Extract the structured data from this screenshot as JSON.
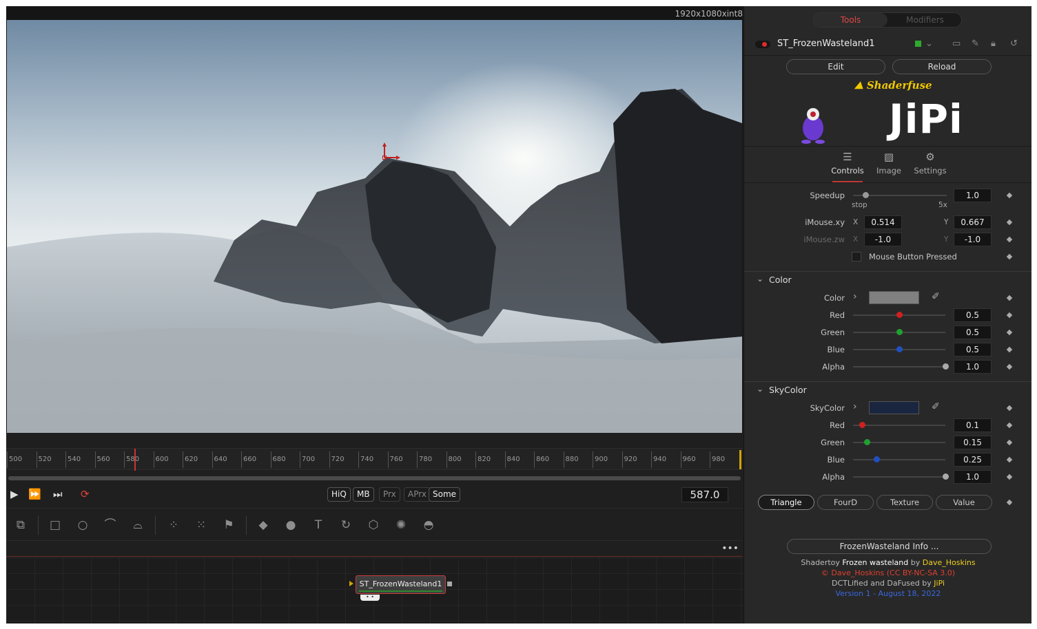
{
  "viewer": {
    "info": "1920x1080xint8"
  },
  "timeline": {
    "ticks": [
      "500",
      "520",
      "540",
      "560",
      "580",
      "600",
      "620",
      "640",
      "660",
      "680",
      "700",
      "720",
      "740",
      "760",
      "780",
      "800",
      "820",
      "840",
      "860",
      "880",
      "900",
      "920",
      "940",
      "960",
      "980"
    ],
    "playhead_frame": 587
  },
  "transport": {
    "pills": [
      "HiQ",
      "MB",
      "Prx",
      "APrx",
      "Some"
    ],
    "current_frame": "587.0"
  },
  "node": {
    "name": "ST_FrozenWasteland1"
  },
  "inspector": {
    "tab_tools": "Tools",
    "tab_modifiers": "Modifiers",
    "tool_name": "ST_FrozenWasteland1",
    "edit": "Edit",
    "reload": "Reload",
    "shaderfuse": "Shaderfuse",
    "brand": "JiPi",
    "tabs": [
      "Controls",
      "Image",
      "Settings"
    ],
    "speedup": {
      "label": "Speedup",
      "value": "1.0",
      "min_label": "stop",
      "max_label": "5x",
      "fraction": 0.13
    },
    "imouse_xy": {
      "label": "iMouse.xy",
      "x_label": "X",
      "y_label": "Y",
      "x": "0.514",
      "y": "0.667"
    },
    "imouse_zw": {
      "label": "iMouse.zw",
      "x_label": "X",
      "y_label": "Y",
      "x": "-1.0",
      "y": "-1.0"
    },
    "mouse_pressed": "Mouse Button Pressed",
    "color_section": {
      "title": "Color",
      "swatch_label": "Color",
      "swatch_color": "#808080",
      "channels": [
        {
          "label": "Red",
          "value": "0.5",
          "fraction": 0.5,
          "dot": "#d02020"
        },
        {
          "label": "Green",
          "value": "0.5",
          "fraction": 0.5,
          "dot": "#20a030"
        },
        {
          "label": "Blue",
          "value": "0.5",
          "fraction": 0.5,
          "dot": "#2050c0"
        },
        {
          "label": "Alpha",
          "value": "1.0",
          "fraction": 1.0,
          "dot": "#aaaaaa"
        }
      ]
    },
    "sky_section": {
      "title": "SkyColor",
      "swatch_label": "SkyColor",
      "swatch_color": "#1a2640",
      "channels": [
        {
          "label": "Red",
          "value": "0.1",
          "fraction": 0.1,
          "dot": "#d02020"
        },
        {
          "label": "Green",
          "value": "0.15",
          "fraction": 0.15,
          "dot": "#20a030"
        },
        {
          "label": "Blue",
          "value": "0.25",
          "fraction": 0.25,
          "dot": "#2050c0"
        },
        {
          "label": "Alpha",
          "value": "1.0",
          "fraction": 1.0,
          "dot": "#aaaaaa"
        }
      ]
    },
    "modes": [
      "Triangle",
      "FourD",
      "Texture",
      "Value"
    ],
    "info_button": "FrozenWasteland Info ...",
    "info1_a": "Shadertoy",
    "info1_b": "Frozen wasteland",
    "info1_c": "by",
    "info1_d": "Dave_Hoskins",
    "info2": "© Dave_Hoskins (CC BY-NC-SA 3.0)",
    "info3_a": "DCTLified and DaFused by",
    "info3_b": "JiPi",
    "info4": "Version 1 - August 18, 2022"
  }
}
